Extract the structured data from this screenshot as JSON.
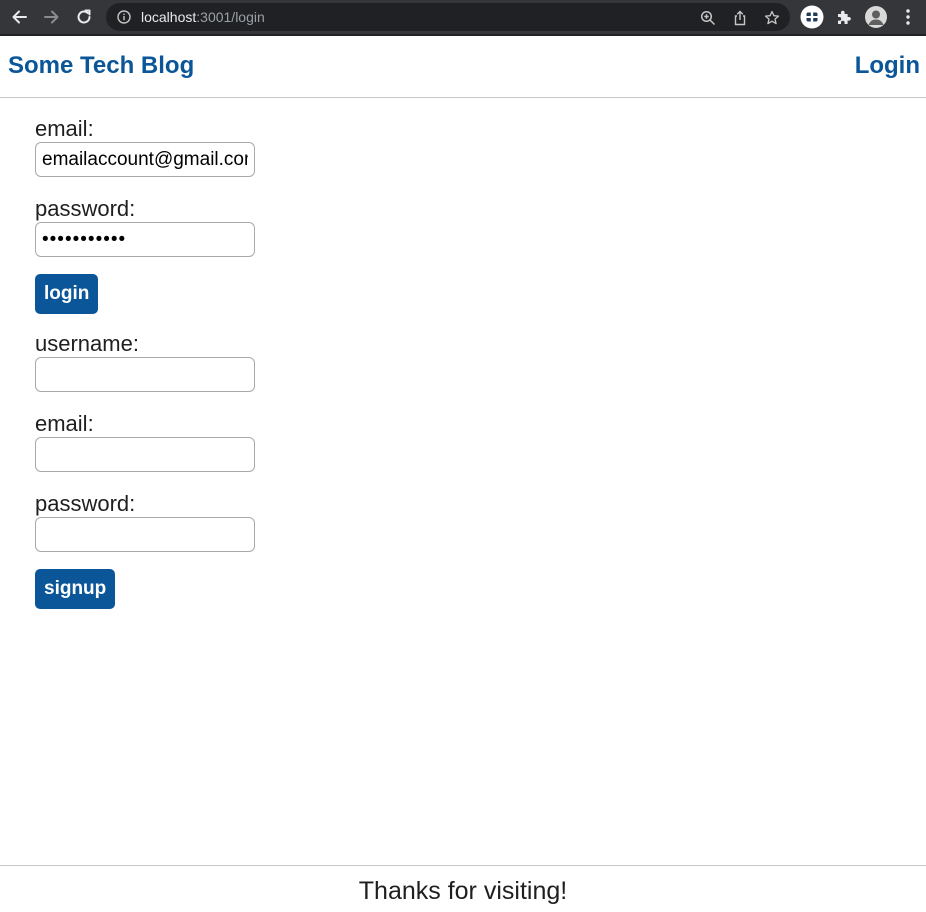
{
  "browser": {
    "url_host": "localhost",
    "url_path": ":3001/login"
  },
  "header": {
    "brand": "Some Tech Blog",
    "nav_login": "Login"
  },
  "login_form": {
    "email_label": "email:",
    "email_value": "emailaccount@gmail.com",
    "password_label": "password:",
    "password_value": "•••••••••••",
    "submit_label": "login"
  },
  "signup_form": {
    "username_label": "username:",
    "username_value": "",
    "email_label": "email:",
    "email_value": "",
    "password_label": "password:",
    "password_value": "",
    "submit_label": "signup"
  },
  "footer": {
    "text": "Thanks for visiting!"
  },
  "colors": {
    "brand_blue": "#0a5699",
    "chrome_dark": "#35363a",
    "omnibox": "#202124"
  },
  "icons": {
    "back": "arrow-left-icon",
    "forward": "arrow-right-icon",
    "reload": "reload-icon",
    "site_info": "info-icon",
    "zoom": "zoom-icon",
    "share": "share-icon",
    "bookmark": "star-icon",
    "extension_app": "extension-app-icon",
    "extensions": "puzzle-icon",
    "profile": "profile-avatar-icon",
    "menu": "kebab-menu-icon"
  }
}
